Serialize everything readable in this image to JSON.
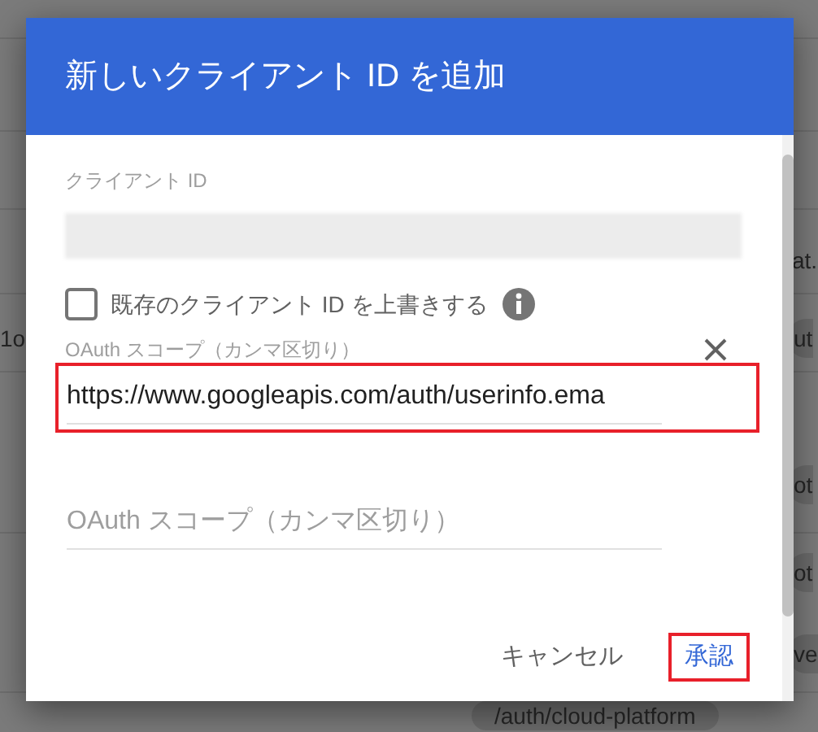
{
  "background": {
    "fragments": [
      {
        "text": "at.",
        "chip": false
      },
      {
        "text": "1o",
        "chip": false
      },
      {
        "text": "ut",
        "chip": true
      },
      {
        "text": "ot",
        "chip": true
      },
      {
        "text": "ot",
        "chip": true
      },
      {
        "text": "ve",
        "chip": true
      },
      {
        "text": "/auth/cloud-platform",
        "chip": true
      }
    ]
  },
  "dialog": {
    "title": "新しいクライアント ID を追加",
    "client_id": {
      "label": "クライアント ID"
    },
    "overwrite": {
      "label": "既存のクライアント ID を上書きする",
      "checked": false
    },
    "scope_fields": [
      {
        "label": "OAuth スコープ（カンマ区切り）",
        "value": "https://www.googleapis.com/auth/userinfo.ema",
        "highlighted": true
      },
      {
        "placeholder": "OAuth スコープ（カンマ区切り）",
        "highlighted": false
      }
    ],
    "buttons": [
      {
        "label": "キャンセル",
        "kind": "text",
        "highlighted": false
      },
      {
        "label": "承認",
        "kind": "primary",
        "highlighted": true
      }
    ]
  }
}
